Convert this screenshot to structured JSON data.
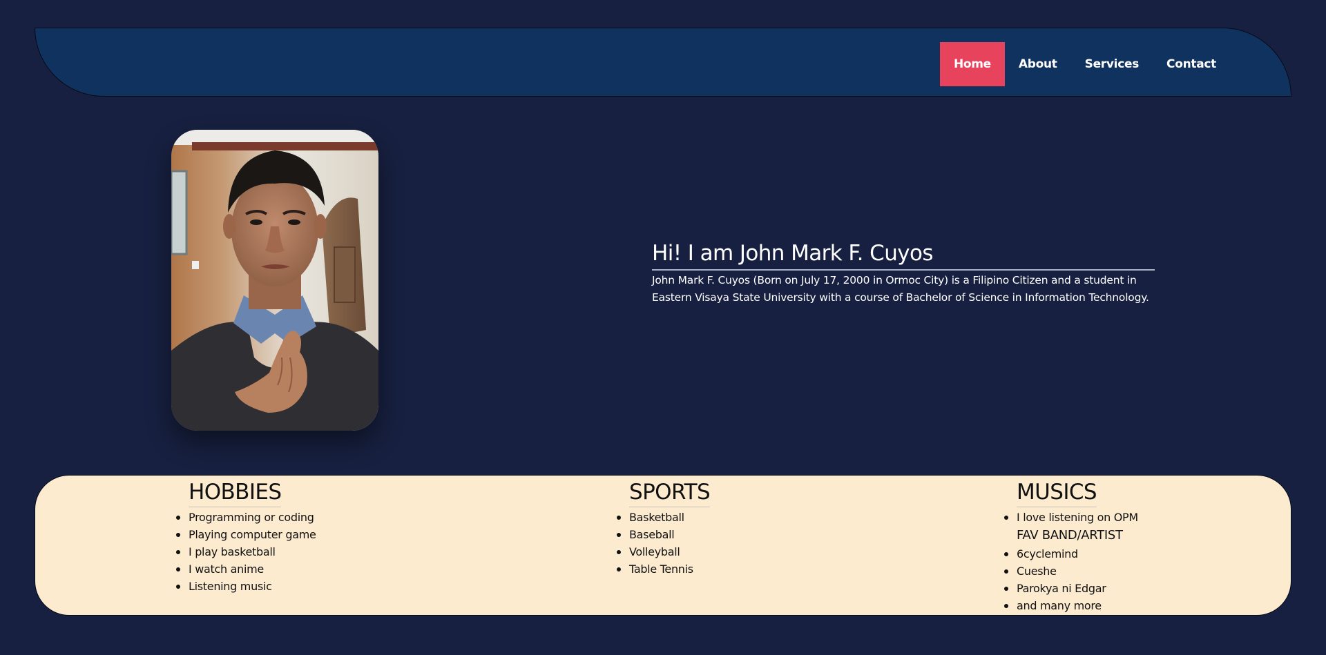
{
  "nav": {
    "items": [
      {
        "label": "Home",
        "active": true
      },
      {
        "label": "About",
        "active": false
      },
      {
        "label": "Services",
        "active": false
      },
      {
        "label": "Contact",
        "active": false
      }
    ]
  },
  "intro": {
    "title": "Hi! I am John Mark F. Cuyos",
    "description": "John Mark F. Cuyos (Born on July 17, 2000 in Ormoc City) is a Filipino Citizen and a student in Eastern Visaya State University with a course of Bachelor of Science in Information Technology."
  },
  "interests": {
    "hobbies": {
      "title": "HOBBIES",
      "items": [
        "Programming or coding",
        "Playing computer game",
        "I play basketball",
        "I watch anime",
        "Listening music"
      ]
    },
    "sports": {
      "title": "SPORTS",
      "items": [
        "Basketball",
        "Baseball",
        "Volleyball",
        "Table Tennis"
      ]
    },
    "musics": {
      "title": "MUSICS",
      "items": [
        "I love listening on OPM"
      ],
      "fav_heading": "FAV BAND/ARTIST",
      "fav_items": [
        "6cyclemind",
        "Cueshe",
        "Parokya ni Edgar",
        "and many more"
      ]
    }
  },
  "colors": {
    "background": "#172040",
    "navbar": "#10325f",
    "active_nav": "#e8435c",
    "interests_panel": "#fdebd0"
  }
}
